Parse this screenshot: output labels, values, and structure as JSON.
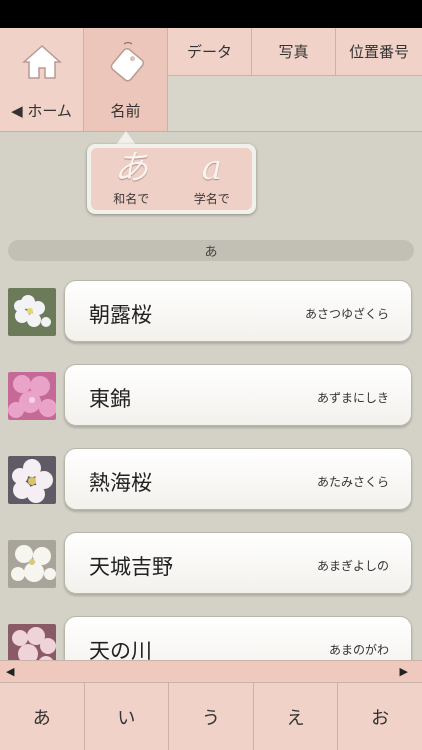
{
  "nav": {
    "home_label": "◀ ホーム",
    "name_label": "名前",
    "data_label": "データ",
    "photo_label": "写真",
    "position_label": "位置番号"
  },
  "sort_popover": {
    "japanese": {
      "glyph": "あ",
      "label": "和名で"
    },
    "scientific": {
      "glyph": "a",
      "label": "学名で"
    }
  },
  "section": {
    "header": "あ"
  },
  "items": [
    {
      "kanji": "朝露桜",
      "kana": "あさつゆざくら",
      "thumb_color": "#f3f3f6"
    },
    {
      "kanji": "東錦",
      "kana": "あずまにしき",
      "thumb_color": "#e59ac0"
    },
    {
      "kanji": "熱海桜",
      "kana": "あたみさくら",
      "thumb_color": "#f5eef2"
    },
    {
      "kanji": "天城吉野",
      "kana": "あまぎよしの",
      "thumb_color": "#f3f1ec"
    },
    {
      "kanji": "天の川",
      "kana": "あまのがわ",
      "thumb_color": "#eed3d8"
    }
  ],
  "scroll": {
    "left": "◀",
    "right": "▶"
  },
  "kana_tabs": [
    "あ",
    "い",
    "う",
    "え",
    "お"
  ],
  "colors": {
    "accent": "#f0d2c8",
    "background": "#d4d2c6"
  }
}
